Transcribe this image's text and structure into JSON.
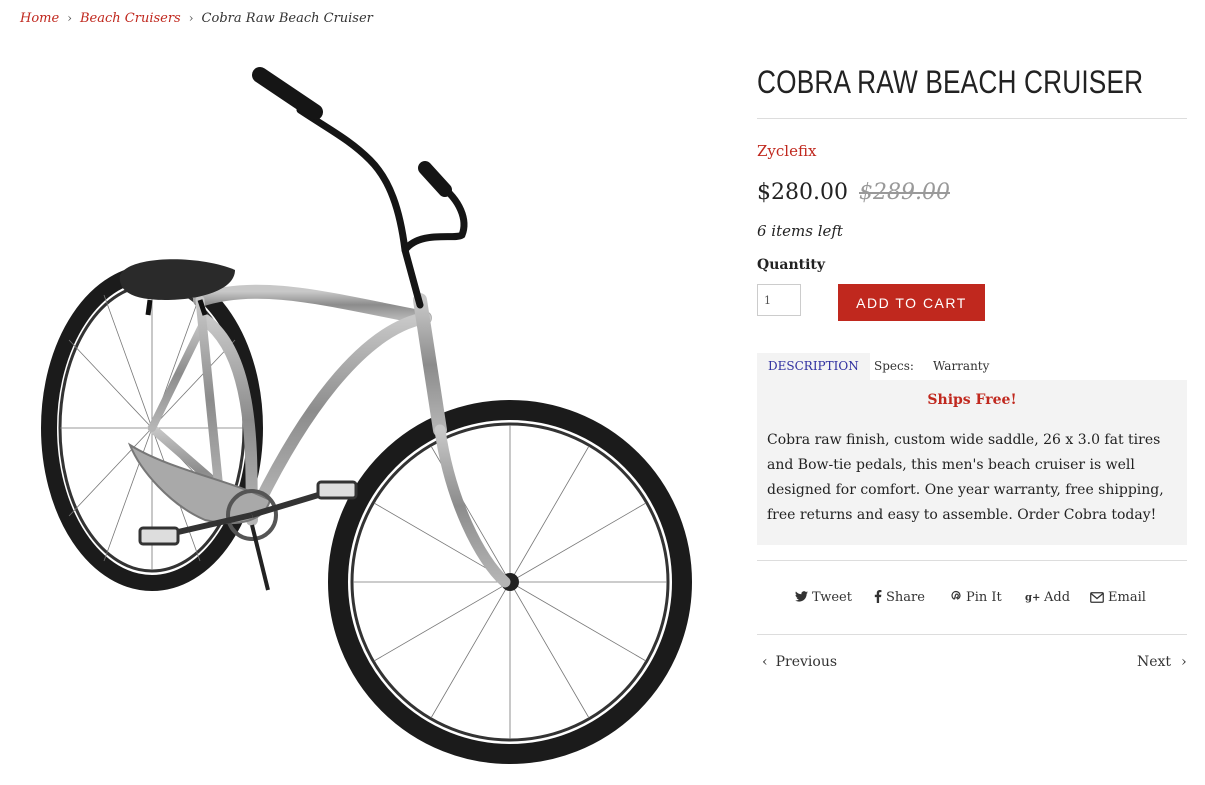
{
  "breadcrumb": {
    "home": "Home",
    "sep": "›",
    "category": "Beach Cruisers",
    "current": "Cobra Raw Beach Cruiser"
  },
  "product": {
    "title": "COBRA RAW BEACH CRUISER",
    "vendor": "Zyclefix",
    "price": "$280.00",
    "compare_price": "$289.00",
    "stock": "6 items left",
    "quantity_label": "Quantity",
    "quantity_value": "1",
    "add_to_cart": "ADD TO CART"
  },
  "tabs": [
    {
      "label": "DESCRIPTION"
    },
    {
      "label": "Specs:"
    },
    {
      "label": "Warranty"
    }
  ],
  "description": {
    "headline": "Ships Free!",
    "body": "Cobra raw finish, custom wide saddle, 26 x 3.0 fat tires and Bow-tie pedals, this men's beach cruiser is well designed for comfort. One year warranty, free shipping, free returns and easy to assemble. Order Cobra today!"
  },
  "share": {
    "tweet": "Tweet",
    "share": "Share",
    "pin": "Pin It",
    "add": "Add",
    "email": "Email"
  },
  "nav": {
    "previous": "Previous",
    "next": "Next",
    "prev_chevron": "‹",
    "next_chevron": "›"
  },
  "colors": {
    "accent": "#c0281e",
    "tab_active_text": "#2f2fa0",
    "panel_bg": "#f3f3f3"
  }
}
